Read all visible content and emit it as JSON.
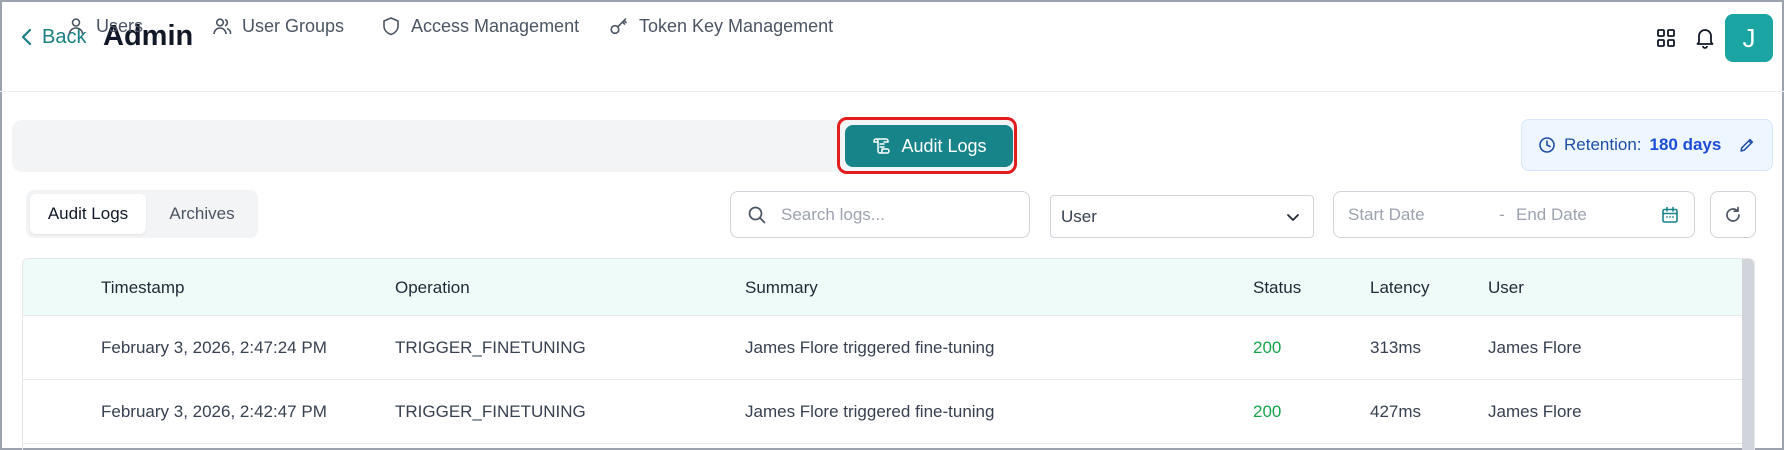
{
  "header": {
    "back_label": "Back",
    "title": "Admin",
    "avatar_initial": "J"
  },
  "tabs": [
    {
      "label": "Users",
      "icon": "user-icon"
    },
    {
      "label": "User Groups",
      "icon": "users-icon"
    },
    {
      "label": "Access Management",
      "icon": "shield-icon"
    },
    {
      "label": "Token Key Management",
      "icon": "key-icon"
    },
    {
      "label": "Audit Logs",
      "icon": "scroll-icon",
      "active": true
    }
  ],
  "retention": {
    "label": "Retention:",
    "value": "180 days"
  },
  "subtabs": {
    "audit_logs": "Audit Logs",
    "archives": "Archives"
  },
  "filters": {
    "search_placeholder": "Search logs...",
    "user_select_value": "User",
    "start_date_placeholder": "Start Date",
    "separator": "-",
    "end_date_placeholder": "End Date"
  },
  "table": {
    "columns": [
      "Timestamp",
      "Operation",
      "Summary",
      "Status",
      "Latency",
      "User"
    ],
    "rows": [
      [
        "February 3, 2026, 2:47:24 PM",
        "TRIGGER_FINETUNING",
        "James Flore triggered fine-tuning",
        "200",
        "313ms",
        "James Flore"
      ],
      [
        "February 3, 2026, 2:42:47 PM",
        "TRIGGER_FINETUNING",
        "James Flore triggered fine-tuning",
        "200",
        "427ms",
        "James Flore"
      ]
    ]
  },
  "colors": {
    "accent": "#17848a",
    "avatar": "#1aa5a3",
    "status_ok": "#16a34a",
    "highlight": "#e11d1d"
  }
}
